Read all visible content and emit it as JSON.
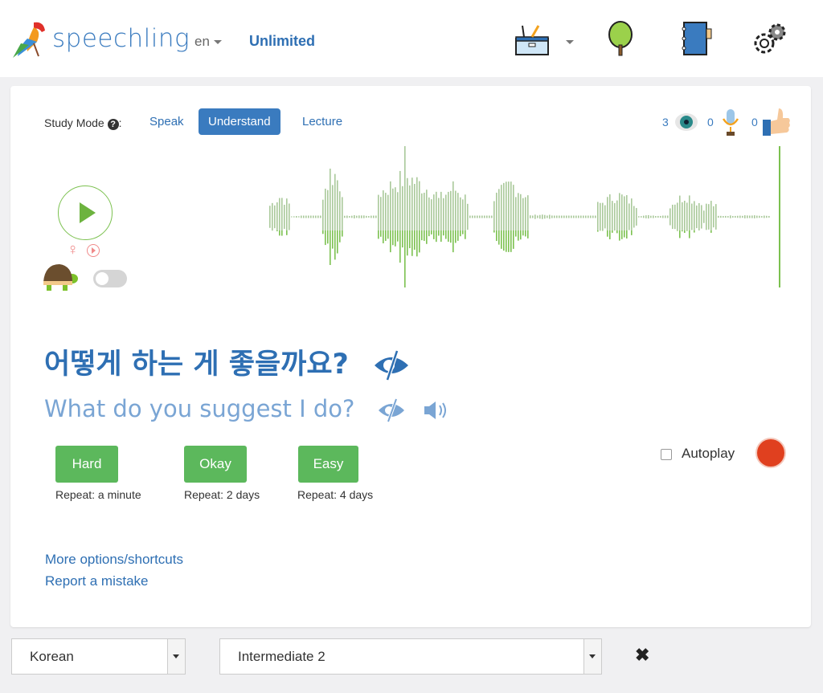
{
  "header": {
    "brand": "speechling",
    "language": "en",
    "plan": "Unlimited",
    "icons": [
      "toolbox-icon",
      "tree-icon",
      "notebook-icon",
      "gear-icon"
    ]
  },
  "study": {
    "label": "Study Mode",
    "modes": [
      {
        "label": "Speak",
        "active": false
      },
      {
        "label": "Understand",
        "active": true
      },
      {
        "label": "Lecture",
        "active": false
      }
    ],
    "counts": {
      "viewed": "3",
      "recorded": "0",
      "liked": "0"
    }
  },
  "audio": {
    "voice": "female",
    "slow_mode": false
  },
  "phrase": {
    "target": "어떻게 하는 게 좋을까요?",
    "translation": "What do you suggest I do?"
  },
  "grading": [
    {
      "label": "Hard",
      "repeat": "Repeat: a minute"
    },
    {
      "label": "Okay",
      "repeat": "Repeat: 2 days"
    },
    {
      "label": "Easy",
      "repeat": "Repeat: 4 days"
    }
  ],
  "autoplay": {
    "label": "Autoplay",
    "checked": false
  },
  "links": {
    "more": "More options/shortcuts",
    "report": "Report a mistake"
  },
  "footer": {
    "language": "Korean",
    "level": "Intermediate 2"
  },
  "colors": {
    "brand": "#3a7bbf",
    "button": "#5cb85c",
    "waveform": "#7cc150",
    "record": "#e0401f"
  }
}
